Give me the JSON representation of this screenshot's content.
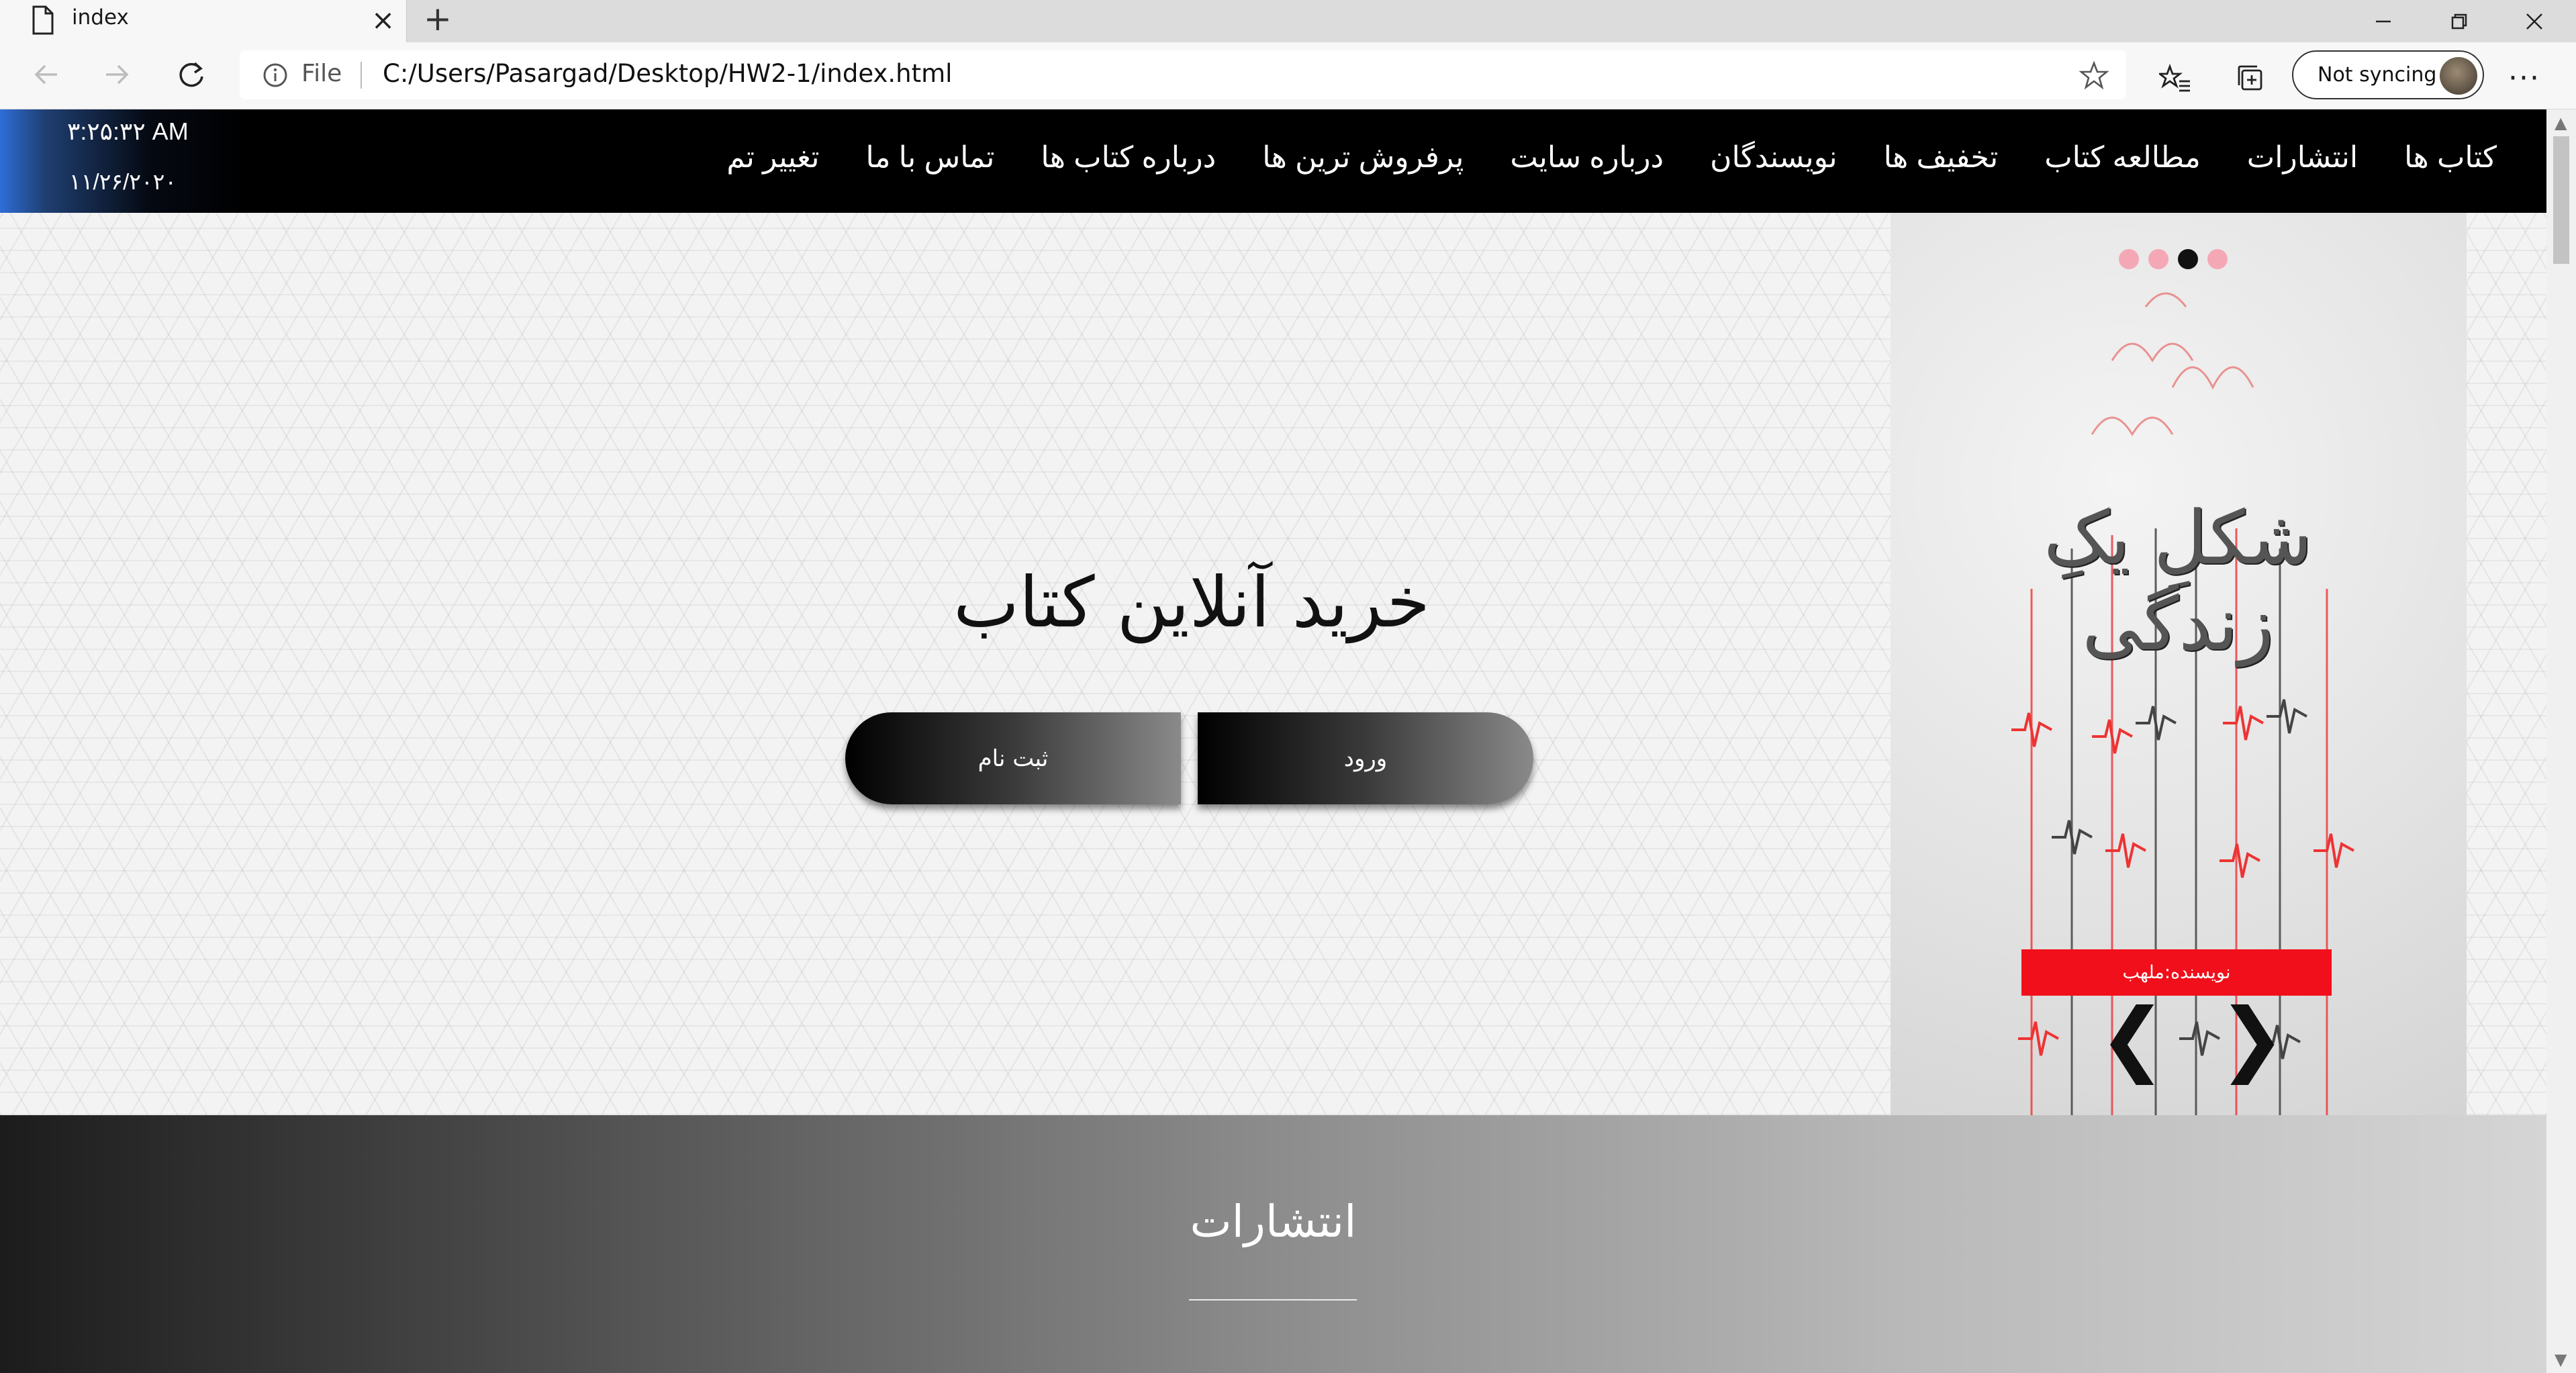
{
  "browser": {
    "tab_title": "index",
    "address_scheme": "File",
    "address_url": "C:/Users/Pasargad/Desktop/HW2-1/index.html",
    "sync_label": "Not syncing"
  },
  "site": {
    "clock_time": "۳:۲۵:۳۲ AM",
    "clock_date": "۱۱/۲۶/۲۰۲۰",
    "nav": [
      "کتاب ها",
      "انتشارات",
      "مطالعه کتاب",
      "تخفیف ها",
      "نویسندگان",
      "درباره سایت",
      "پرفروش ترین ها",
      "درباره کتاب ها",
      "تماس با ما",
      "تغییر تم"
    ],
    "hero_title": "خرید آنلاین کتاب",
    "login_label": "ورود",
    "signup_label": "ثبت نام",
    "slider": {
      "book_title": "شکلِ یکِ زندگی",
      "author": "نویسنده:ملهب",
      "prev_arrow": "❮",
      "next_arrow": "❯",
      "slide_count": 4,
      "active_slide": 3
    },
    "publications_title": "انتشارات"
  },
  "colors": {
    "nav_bg": "#000000",
    "dot_inactive": "#f4a8b6",
    "dot_active": "#111111",
    "author_band": "#f00f1a"
  }
}
